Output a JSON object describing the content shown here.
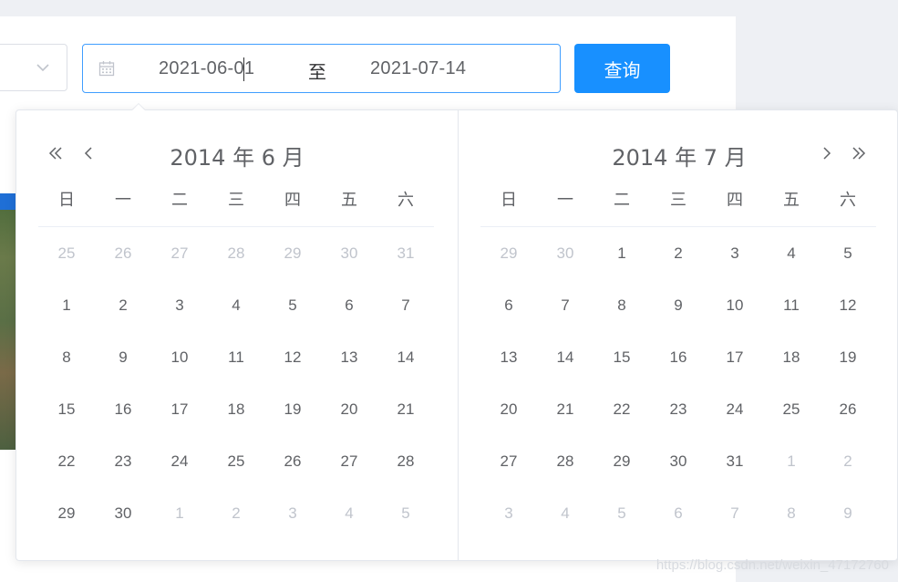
{
  "filter": {
    "start_date": "2021-06-01",
    "range_separator": "至",
    "end_date": "2021-07-14",
    "query_button": "查询"
  },
  "calendar": {
    "weekdays": [
      "日",
      "一",
      "二",
      "三",
      "四",
      "五",
      "六"
    ],
    "left": {
      "title": "2014 年 6 月",
      "weeks": [
        [
          {
            "d": "25",
            "m": true
          },
          {
            "d": "26",
            "m": true
          },
          {
            "d": "27",
            "m": true
          },
          {
            "d": "28",
            "m": true
          },
          {
            "d": "29",
            "m": true
          },
          {
            "d": "30",
            "m": true
          },
          {
            "d": "31",
            "m": true
          }
        ],
        [
          {
            "d": "1"
          },
          {
            "d": "2"
          },
          {
            "d": "3"
          },
          {
            "d": "4"
          },
          {
            "d": "5"
          },
          {
            "d": "6"
          },
          {
            "d": "7"
          }
        ],
        [
          {
            "d": "8"
          },
          {
            "d": "9"
          },
          {
            "d": "10"
          },
          {
            "d": "11"
          },
          {
            "d": "12"
          },
          {
            "d": "13"
          },
          {
            "d": "14"
          }
        ],
        [
          {
            "d": "15"
          },
          {
            "d": "16"
          },
          {
            "d": "17"
          },
          {
            "d": "18"
          },
          {
            "d": "19"
          },
          {
            "d": "20"
          },
          {
            "d": "21"
          }
        ],
        [
          {
            "d": "22"
          },
          {
            "d": "23"
          },
          {
            "d": "24"
          },
          {
            "d": "25"
          },
          {
            "d": "26"
          },
          {
            "d": "27"
          },
          {
            "d": "28"
          }
        ],
        [
          {
            "d": "29"
          },
          {
            "d": "30"
          },
          {
            "d": "1",
            "m": true
          },
          {
            "d": "2",
            "m": true
          },
          {
            "d": "3",
            "m": true
          },
          {
            "d": "4",
            "m": true
          },
          {
            "d": "5",
            "m": true
          }
        ]
      ]
    },
    "right": {
      "title": "2014 年 7 月",
      "weeks": [
        [
          {
            "d": "29",
            "m": true
          },
          {
            "d": "30",
            "m": true
          },
          {
            "d": "1"
          },
          {
            "d": "2"
          },
          {
            "d": "3"
          },
          {
            "d": "4"
          },
          {
            "d": "5"
          }
        ],
        [
          {
            "d": "6"
          },
          {
            "d": "7"
          },
          {
            "d": "8"
          },
          {
            "d": "9"
          },
          {
            "d": "10"
          },
          {
            "d": "11"
          },
          {
            "d": "12"
          }
        ],
        [
          {
            "d": "13"
          },
          {
            "d": "14"
          },
          {
            "d": "15"
          },
          {
            "d": "16"
          },
          {
            "d": "17"
          },
          {
            "d": "18"
          },
          {
            "d": "19"
          }
        ],
        [
          {
            "d": "20"
          },
          {
            "d": "21"
          },
          {
            "d": "22"
          },
          {
            "d": "23"
          },
          {
            "d": "24"
          },
          {
            "d": "25"
          },
          {
            "d": "26"
          }
        ],
        [
          {
            "d": "27"
          },
          {
            "d": "28"
          },
          {
            "d": "29"
          },
          {
            "d": "30"
          },
          {
            "d": "31"
          },
          {
            "d": "1",
            "m": true
          },
          {
            "d": "2",
            "m": true
          }
        ],
        [
          {
            "d": "3",
            "m": true
          },
          {
            "d": "4",
            "m": true
          },
          {
            "d": "5",
            "m": true
          },
          {
            "d": "6",
            "m": true
          },
          {
            "d": "7",
            "m": true
          },
          {
            "d": "8",
            "m": true
          },
          {
            "d": "9",
            "m": true
          }
        ]
      ]
    }
  },
  "icons": {
    "calendar": "calendar-icon",
    "select_arrow": "chevron-down-icon",
    "prev_year": "double-chevron-left-icon",
    "prev_month": "chevron-left-icon",
    "next_month": "chevron-right-icon",
    "next_year": "double-chevron-right-icon"
  },
  "colors": {
    "primary": "#1890ff",
    "focus_border": "#409eff",
    "text": "#606266",
    "muted_day": "#c0c4cc"
  },
  "watermark": "https://blog.csdn.net/weixin_47172760"
}
